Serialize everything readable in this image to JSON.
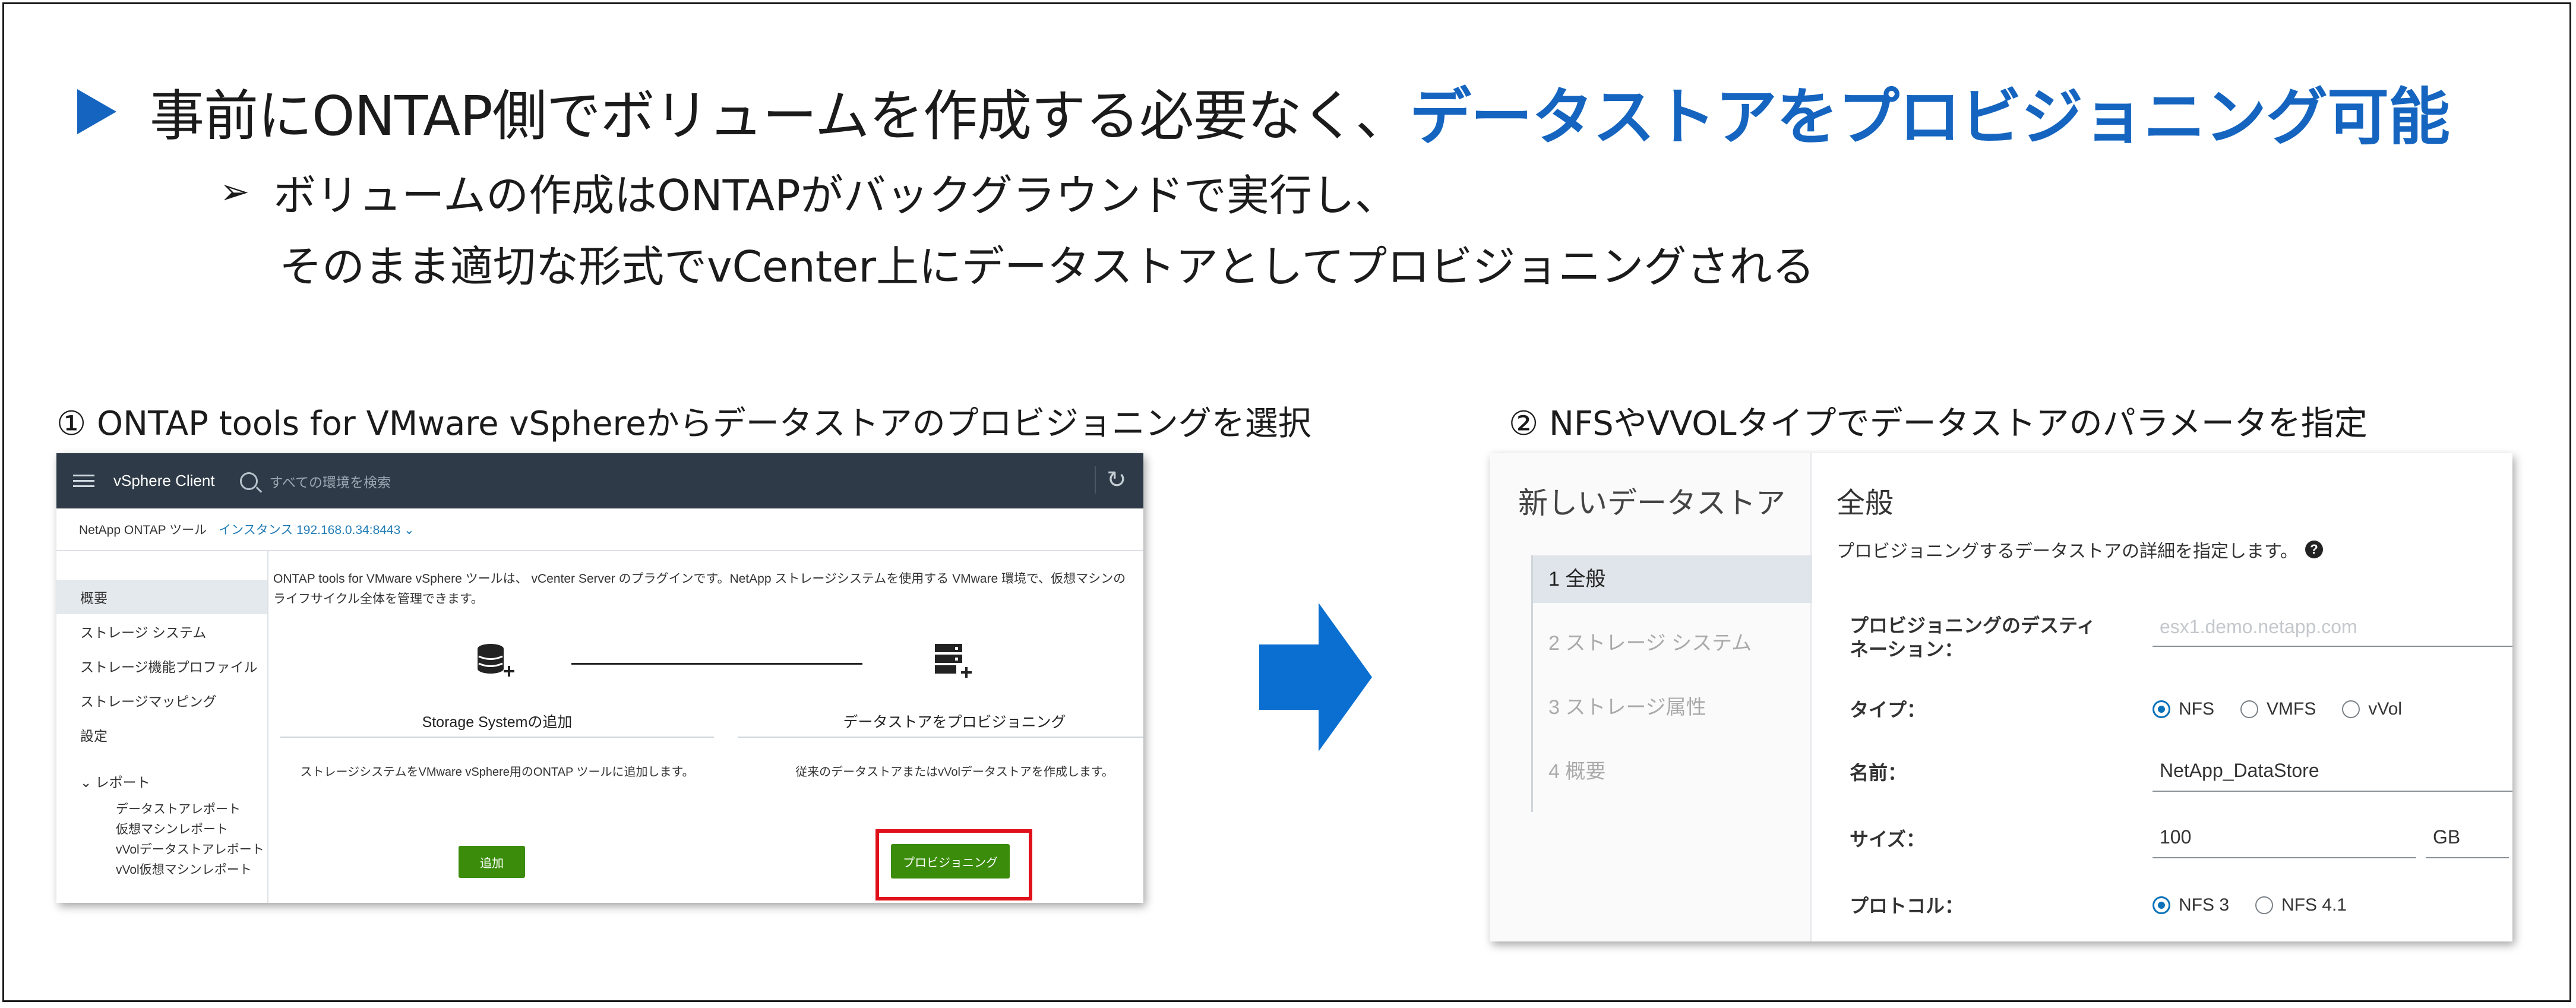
{
  "slide": {
    "headline_plain": "事前にONTAP側でボリュームを作成する必要なく、",
    "headline_strong": "データストアをプロビジョニング可能",
    "bullet_marker": "➢",
    "sub_line1": "ボリュームの作成はONTAPがバックグラウンドで実行し、",
    "sub_line2": "そのまま適切な形式でvCenter上にデータストアとしてプロビジョニングされる",
    "caption_left": "① ONTAP tools for VMware vSphereからデータストアのプロビジョニングを選択",
    "caption_right": "② NFSやVVOLタイプでデータストアのパラメータを指定",
    "accent_color": "#1565c0"
  },
  "vsphere": {
    "app_title": "vSphere Client",
    "search_placeholder": "すべての環境を検索",
    "plugin_label": "NetApp ONTAP ツール",
    "instance_label": "インスタンス 192.168.0.34:8443 ⌄",
    "sidebar": {
      "items": [
        "概要",
        "ストレージ システム",
        "ストレージ機能プロファイル",
        "ストレージマッピング",
        "設定"
      ],
      "reports_label": "⌄ レポート",
      "report_items": [
        "データストアレポート",
        "仮想マシンレポート",
        "vVolデータストアレポート",
        "vVol仮想マシンレポート"
      ]
    },
    "intro_text": "ONTAP tools for VMware vSphere ツールは、 vCenter Server のプラグインです。NetApp ストレージシステムを使用する VMware 環境で、仮想マシンのライフサイクル全体を管理できます。",
    "panel_left": {
      "title": "Storage Systemの追加",
      "desc": "ストレージシステムをVMware vSphere用のONTAP ツールに追加します。",
      "button": "追加"
    },
    "panel_right": {
      "title": "データストアをプロビジョニング",
      "desc": "従来のデータストアまたはvVolデータストアを作成します。",
      "button": "プロビジョニング"
    }
  },
  "wizard": {
    "title": "新しいデータストア",
    "steps": [
      "1 全般",
      "2 ストレージ システム",
      "3 ストレージ属性",
      "4 概要"
    ],
    "heading": "全般",
    "description": "プロビジョニングするデータストアの詳細を指定します。",
    "destination_label": "プロビジョニングのデスティネーション：",
    "destination_placeholder": "esx1.demo.netapp.com",
    "type_label": "タイプ：",
    "type_options": [
      "NFS",
      "VMFS",
      "vVol"
    ],
    "type_selected": "NFS",
    "name_label": "名前：",
    "name_value": "NetApp_DataStore",
    "size_label": "サイズ：",
    "size_value": "100",
    "size_unit": "GB",
    "protocol_label": "プロトコル：",
    "protocol_options": [
      "NFS 3",
      "NFS 4.1"
    ],
    "protocol_selected": "NFS 3"
  }
}
